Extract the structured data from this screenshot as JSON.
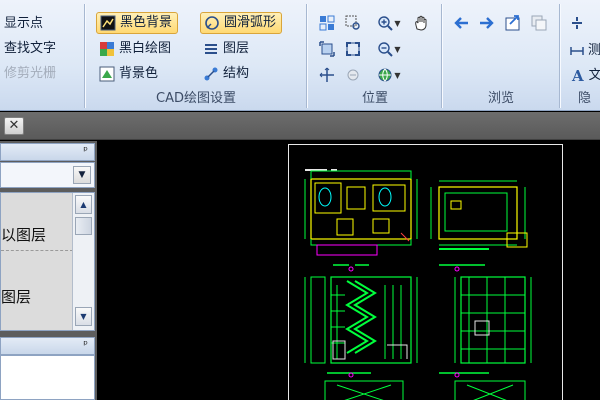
{
  "ribbon": {
    "display_group": {
      "show_points_label": "显示点",
      "find_text_label": "查找文字",
      "trim_raster_label": "修剪光栅"
    },
    "cad_settings": {
      "label": "CAD绘图设置",
      "black_background_label": "黑色背景",
      "smooth_arc_label": "圆滑弧形",
      "black_white_label": "黑白绘图",
      "layers_label": "图层",
      "background_color_label": "背景色",
      "structure_label": "结构"
    },
    "position": {
      "label": "位置"
    },
    "browse": {
      "label": "浏览"
    },
    "hidden": {
      "label": "隐",
      "text_label": "文",
      "measure_label": "测"
    }
  },
  "tabs": {
    "close_label": "✕"
  },
  "left_panel": {
    "pin_label": "ᵖ",
    "list_items": [
      "以图层",
      "图层"
    ],
    "scroll_up": "▲",
    "scroll_down": "▼",
    "combo_arrow": "▼"
  },
  "colors": {
    "ribbon_bg": "#dde8f6",
    "active_highlight": "#ffd973",
    "drawing_green": "#00ff3c",
    "drawing_yellow": "#ffff00",
    "drawing_magenta": "#ff00ff"
  }
}
